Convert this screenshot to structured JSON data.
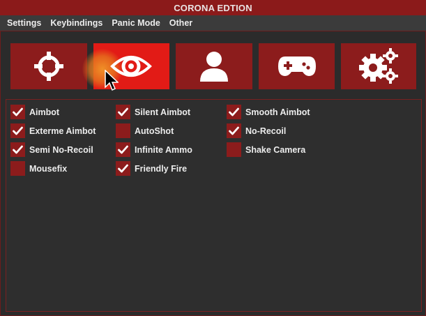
{
  "window": {
    "title": "CORONA EDTION"
  },
  "menubar": {
    "items": [
      "Settings",
      "Keybindings",
      "Panic Mode",
      "Other"
    ]
  },
  "tabs": [
    {
      "icon": "crosshair-icon",
      "active": false
    },
    {
      "icon": "eye-icon",
      "active": true
    },
    {
      "icon": "user-icon",
      "active": false
    },
    {
      "icon": "gamepad-icon",
      "active": false
    },
    {
      "icon": "gears-icon",
      "active": false
    }
  ],
  "options": {
    "col1": [
      {
        "label": "Aimbot",
        "checked": true
      },
      {
        "label": "Exterme Aimbot",
        "checked": true
      },
      {
        "label": "Semi No-Recoil",
        "checked": true
      },
      {
        "label": "Mousefix",
        "checked": false
      }
    ],
    "col2": [
      {
        "label": "Silent Aimbot",
        "checked": true
      },
      {
        "label": "AutoShot",
        "checked": false
      },
      {
        "label": "Infinite Ammo",
        "checked": true
      },
      {
        "label": "Friendly Fire",
        "checked": true
      }
    ],
    "col3": [
      {
        "label": "Smooth Aimbot",
        "checked": true
      },
      {
        "label": "No-Recoil",
        "checked": true
      },
      {
        "label": "Shake Camera",
        "checked": false
      }
    ]
  },
  "colors": {
    "accent": "#8c1c1c",
    "active_tab": "#e21b16",
    "background": "#2a2a2a"
  }
}
